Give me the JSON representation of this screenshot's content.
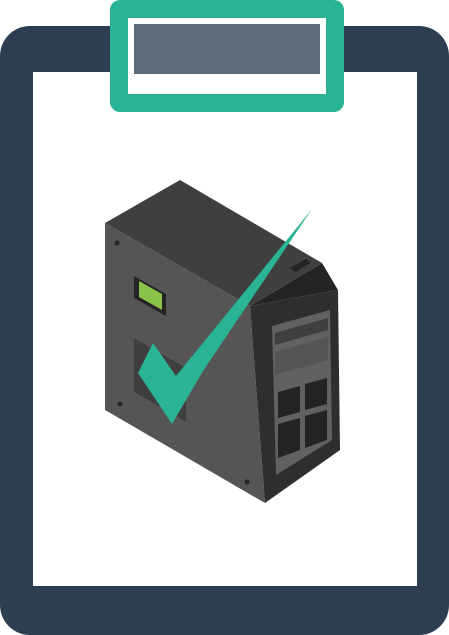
{
  "illustration": {
    "icon": "clipboard-computer-checkmark-icon",
    "colors": {
      "board": "#2c3e50",
      "paper": "#ffffff",
      "clip_frame": "#2ab495",
      "clip_inner": "#5e6b79",
      "case_side": "#555555",
      "case_top": "#3f3f3f",
      "case_front": "#2e2e2e",
      "case_edge": "#242424",
      "front_panel": "#616161",
      "power_light": "#8bc34a",
      "checkmark": "#2ab495"
    }
  }
}
